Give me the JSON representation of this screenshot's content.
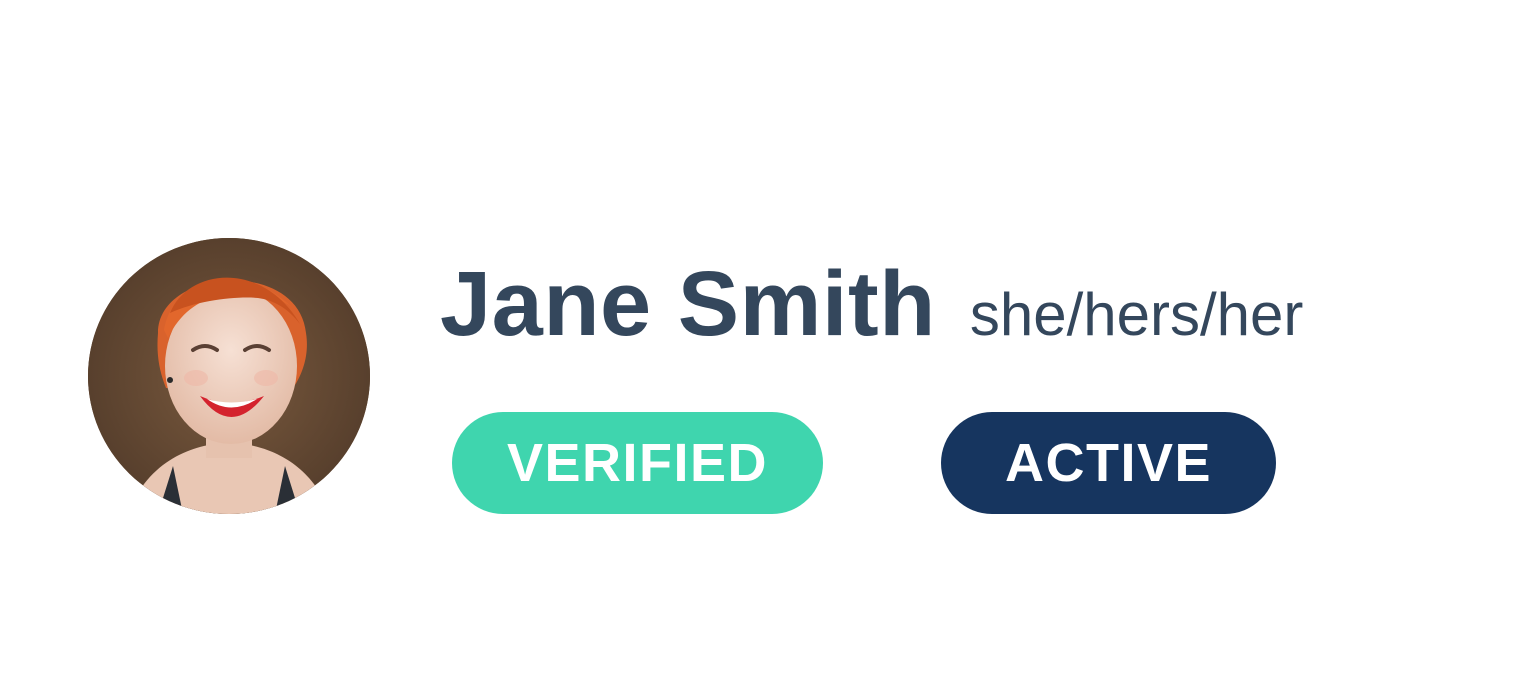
{
  "profile": {
    "name": "Jane Smith",
    "pronouns": "she/hers/her",
    "avatar_icon": "profile-photo"
  },
  "badges": {
    "verified": {
      "label": "VERIFIED",
      "color": "#3fd5ae"
    },
    "active": {
      "label": "ACTIVE",
      "color": "#16355f"
    }
  },
  "colors": {
    "text": "#34475c",
    "background": "#ffffff"
  }
}
